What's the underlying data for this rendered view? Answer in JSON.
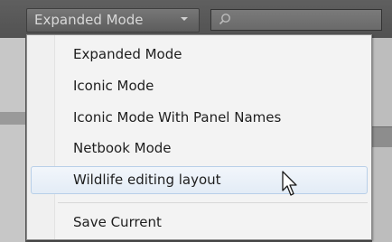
{
  "toolbar": {
    "mode_button_label": "Expanded Mode",
    "search_placeholder": ""
  },
  "menu": {
    "items": [
      {
        "label": "Expanded Mode"
      },
      {
        "label": "Iconic Mode"
      },
      {
        "label": "Iconic Mode With Panel Names"
      },
      {
        "label": "Netbook Mode"
      },
      {
        "label": "Wildlife editing layout",
        "highlighted": true
      },
      {
        "label": "Save Current"
      }
    ]
  },
  "colors": {
    "menu_background": "#f3f3f3",
    "highlight_background": "#e3ecf6",
    "highlight_border": "#b8cfe8",
    "toolbar_background": "#5a5a5a"
  },
  "icons": {
    "search": "magnifier-icon",
    "dropdown": "chevron-down-icon",
    "pointer": "mouse-cursor-icon"
  }
}
